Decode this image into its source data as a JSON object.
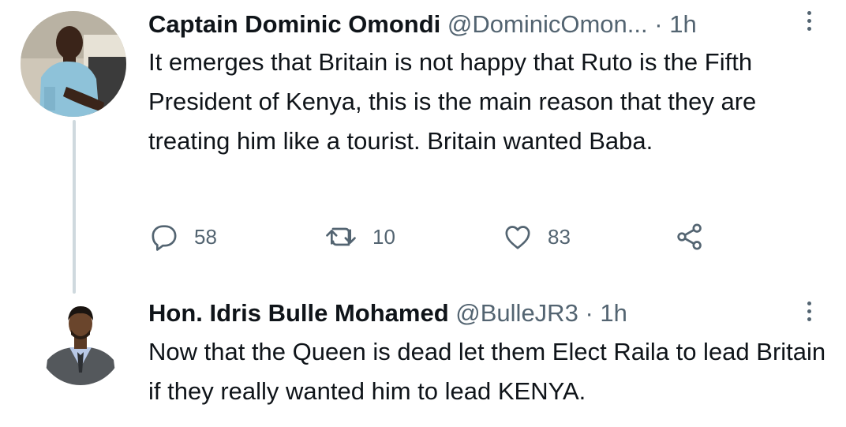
{
  "tweets": [
    {
      "display_name": "Captain Dominic Omondi",
      "handle": "@DominicOmon...",
      "separator": "·",
      "time": "1h",
      "text": "It emerges that Britain is not happy that Ruto is the Fifth President of Kenya, this is the main reason that they are treating him like a tourist. Britain wanted Baba.",
      "actions": {
        "replies": "58",
        "retweets": "10",
        "likes": "83"
      }
    },
    {
      "display_name": "Hon. Idris Bulle Mohamed",
      "handle": "@BulleJR3",
      "separator": "·",
      "time": "1h",
      "text": "Now that the Queen is dead let them Elect Raila to lead Britain if they really wanted him to lead KENYA."
    }
  ],
  "icons": {
    "reply": "speech-bubble-icon",
    "retweet": "retweet-arrows-icon",
    "like": "heart-icon",
    "share": "share-nodes-icon",
    "more": "vertical-dots-icon"
  },
  "colors": {
    "text_primary": "#0f1419",
    "text_secondary": "#536471",
    "thread_line": "#cfd9de"
  }
}
